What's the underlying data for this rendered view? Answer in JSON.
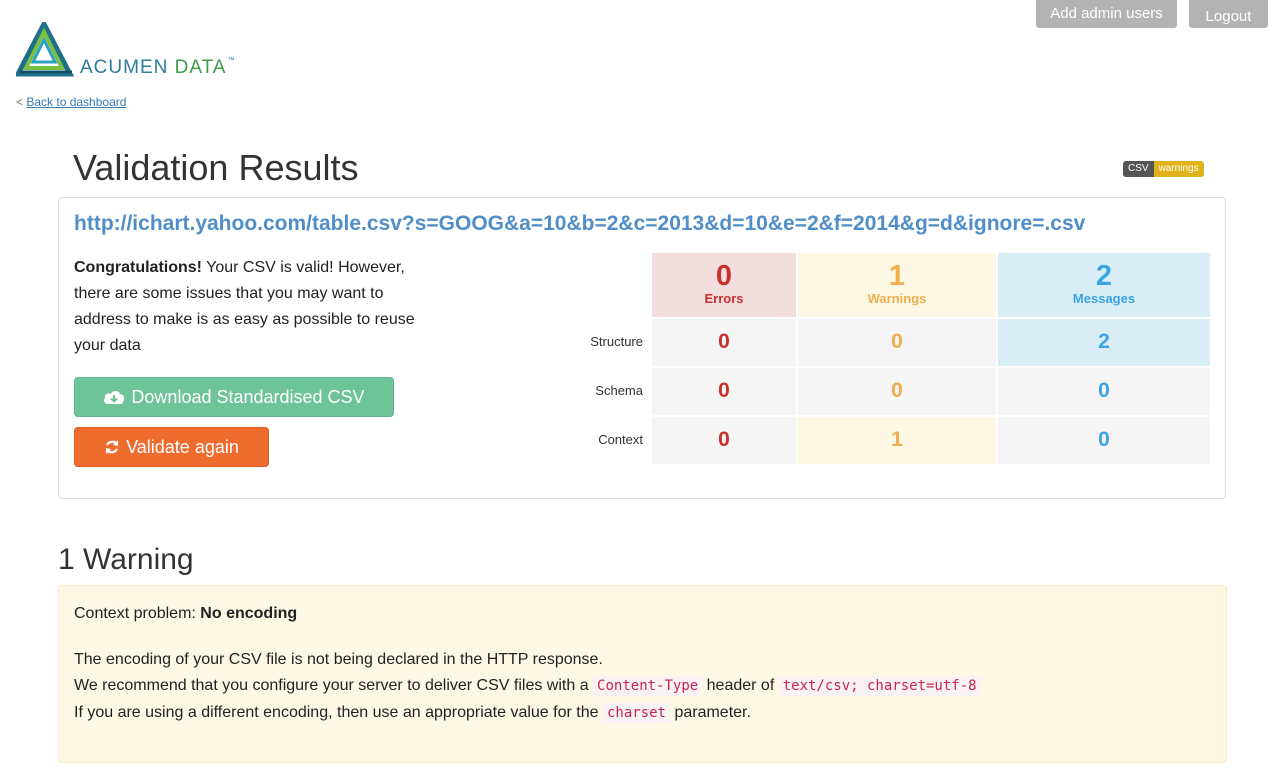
{
  "header": {
    "add_admin_label": "Add admin users",
    "logout_label": "Logout",
    "logo_word1": "ACUMEN",
    "logo_word2": "DATA",
    "logo_tm": "™"
  },
  "nav": {
    "back_prefix": "<",
    "back_label": "Back to dashboard"
  },
  "page": {
    "title": "Validation Results",
    "badge_left": "CSV",
    "badge_right": "warnings"
  },
  "summary": {
    "url": "http://ichart.yahoo.com/table.csv?s=GOOG&a=10&b=2&c=2013&d=10&e=2&f=2014&g=d&ignore=.csv",
    "congrats_bold": "Congratulations!",
    "congrats_text": "Your CSV is valid! However, there are some issues that you may want to address to make is as easy as possible to reuse your data",
    "download_label": "Download Standardised CSV",
    "validate_label": "Validate again"
  },
  "counts": {
    "errors": {
      "value": "0",
      "label": "Errors"
    },
    "warnings": {
      "value": "1",
      "label": "Warnings"
    },
    "messages": {
      "value": "2",
      "label": "Messages"
    },
    "rows": [
      {
        "label": "Structure",
        "errors": "0",
        "warnings": "0",
        "messages": "2"
      },
      {
        "label": "Schema",
        "errors": "0",
        "warnings": "0",
        "messages": "0"
      },
      {
        "label": "Context",
        "errors": "0",
        "warnings": "1",
        "messages": "0"
      }
    ]
  },
  "warnings_section": {
    "heading": "1 Warning",
    "problem_prefix": "Context problem:",
    "problem_name": "No encoding",
    "line1": "The encoding of your CSV file is not being declared in the HTTP response.",
    "line2_a": "We recommend that you configure your server to deliver CSV files with a",
    "line2_code1": "Content-Type",
    "line2_b": "header of",
    "line2_code2": "text/csv; charset=utf-8",
    "line3_a": "If you are using a different encoding, then use an appropriate value for the",
    "line3_code": "charset",
    "line3_b": "parameter."
  },
  "colors": {
    "errors_bg": "#f2dede",
    "warnings_bg": "#fcf8e3",
    "messages_bg": "#d9edf7",
    "cell_bg": "#f5f5f5",
    "download_bg": "#6dc497",
    "validate_bg": "#ef6c2f"
  }
}
